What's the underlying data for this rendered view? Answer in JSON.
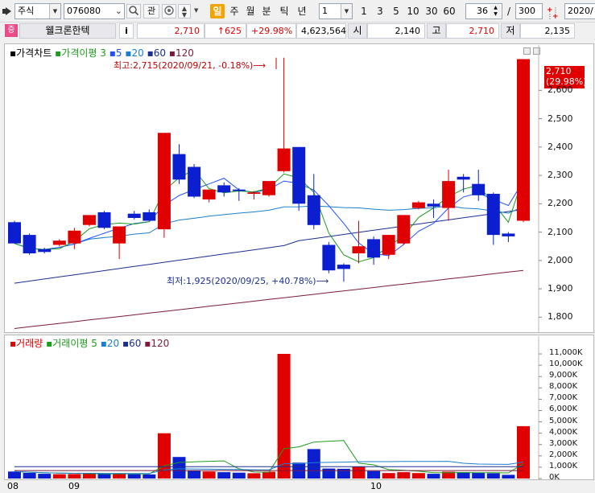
{
  "toolbar": {
    "market": "주식",
    "code": "076080",
    "search_icon": "search-icon",
    "watch_label": "관",
    "periods": [
      "일",
      "주",
      "월",
      "분",
      "틱",
      "년"
    ],
    "active_period": "일",
    "interval": "1",
    "quick_intervals": [
      "1",
      "3",
      "5",
      "10",
      "30",
      "60"
    ],
    "count": "36",
    "count_sep": "/",
    "max_count": "300",
    "date": "2020/"
  },
  "quote": {
    "badge": "증",
    "name": "웰크론한텍",
    "info": "i",
    "price": "2,710",
    "change": "↑625",
    "change_pct": "+29.98%",
    "volume": "4,623,564",
    "open_label": "시",
    "open": "2,140",
    "high_label": "고",
    "high": "2,710",
    "low_label": "저",
    "low": "2,135"
  },
  "price_panel": {
    "legend_main": "가격차트",
    "legend_ma": "가격이평",
    "ma_values": [
      "3",
      "5",
      "20",
      "60",
      "120"
    ],
    "annotation_high": "최고:2,715(2020/09/21, -0.18%)⟶",
    "annotation_low": "최저:1,925(2020/09/25, +40.78%)⟶",
    "current_price": "2,710",
    "current_pct": "(29.98%)",
    "y_ticks": [
      "2,600",
      "2,500",
      "2,400",
      "2,300",
      "2,200",
      "2,100",
      "2,000",
      "1,900",
      "1,800"
    ]
  },
  "volume_panel": {
    "legend_main": "거래량",
    "legend_ma": "거래이평",
    "ma_values": [
      "5",
      "20",
      "60",
      "120"
    ],
    "y_ticks": [
      "11,000K",
      "10,000K",
      "9,000K",
      "8,000K",
      "7,000K",
      "6,000K",
      "5,000K",
      "4,000K",
      "3,000K",
      "2,000K",
      "1,000K",
      "0K"
    ]
  },
  "x_axis": {
    "labels": [
      "08",
      "09",
      "10"
    ]
  },
  "colors": {
    "up": "#e00000",
    "down": "#0b1fd0",
    "ma3": "#1e9b1e",
    "ma5": "#1f50ff",
    "ma20": "#1a7fc9",
    "ma60": "#1a2f8f",
    "ma120": "#7b1a3a"
  },
  "chart_data": {
    "type": "candlestick",
    "ylim": [
      1750,
      2720
    ],
    "candles": [
      {
        "o": 2135,
        "h": 2140,
        "c": 2060,
        "l": 2060
      },
      {
        "o": 2090,
        "h": 2095,
        "c": 2025,
        "l": 2020
      },
      {
        "o": 2040,
        "h": 2045,
        "c": 2030,
        "l": 2025
      },
      {
        "o": 2055,
        "h": 2075,
        "c": 2070,
        "l": 2050
      },
      {
        "o": 2060,
        "h": 2115,
        "c": 2105,
        "l": 2040
      },
      {
        "o": 2125,
        "h": 2160,
        "c": 2160,
        "l": 2120
      },
      {
        "o": 2170,
        "h": 2175,
        "c": 2115,
        "l": 2110
      },
      {
        "o": 2060,
        "h": 2120,
        "c": 2120,
        "l": 2005
      },
      {
        "o": 2165,
        "h": 2175,
        "c": 2150,
        "l": 2145
      },
      {
        "o": 2170,
        "h": 2180,
        "c": 2140,
        "l": 2140
      },
      {
        "o": 2110,
        "h": 2450,
        "c": 2450,
        "l": 2080
      },
      {
        "o": 2375,
        "h": 2410,
        "c": 2285,
        "l": 2270
      },
      {
        "o": 2330,
        "h": 2340,
        "c": 2225,
        "l": 2220
      },
      {
        "o": 2215,
        "h": 2250,
        "c": 2250,
        "l": 2205
      },
      {
        "o": 2265,
        "h": 2275,
        "c": 2240,
        "l": 2225
      },
      {
        "o": 2250,
        "h": 2255,
        "c": 2245,
        "l": 2210
      },
      {
        "o": 2235,
        "h": 2245,
        "c": 2240,
        "l": 2215
      },
      {
        "o": 2230,
        "h": 2280,
        "c": 2280,
        "l": 2225
      },
      {
        "o": 2315,
        "h": 2715,
        "c": 2395,
        "l": 2310
      },
      {
        "o": 2400,
        "h": 2400,
        "c": 2200,
        "l": 2175
      },
      {
        "o": 2230,
        "h": 2305,
        "c": 2125,
        "l": 2110
      },
      {
        "o": 2055,
        "h": 2065,
        "c": 1965,
        "l": 1955
      },
      {
        "o": 1985,
        "h": 1990,
        "c": 1970,
        "l": 1925
      },
      {
        "o": 2025,
        "h": 2140,
        "c": 2050,
        "l": 1990
      },
      {
        "o": 2075,
        "h": 2085,
        "c": 2010,
        "l": 1985
      },
      {
        "o": 2020,
        "h": 2090,
        "c": 2090,
        "l": 2005
      },
      {
        "o": 2060,
        "h": 2160,
        "c": 2160,
        "l": 2055
      },
      {
        "o": 2185,
        "h": 2210,
        "c": 2205,
        "l": 2180
      },
      {
        "o": 2200,
        "h": 2215,
        "c": 2190,
        "l": 2150
      },
      {
        "o": 2185,
        "h": 2320,
        "c": 2280,
        "l": 2140
      },
      {
        "o": 2295,
        "h": 2305,
        "c": 2285,
        "l": 2240
      },
      {
        "o": 2270,
        "h": 2320,
        "c": 2230,
        "l": 2210
      },
      {
        "o": 2235,
        "h": 2240,
        "c": 2090,
        "l": 2055
      },
      {
        "o": 2095,
        "h": 2100,
        "c": 2085,
        "l": 2065
      },
      {
        "o": 2140,
        "h": 2710,
        "c": 2710,
        "l": 2135
      }
    ],
    "volume_k": [
      620,
      500,
      420,
      380,
      400,
      480,
      390,
      450,
      380,
      360,
      4000,
      1900,
      700,
      620,
      560,
      520,
      470,
      600,
      11000,
      1400,
      2600,
      880,
      860,
      1050,
      660,
      480,
      560,
      480,
      420,
      600,
      560,
      530,
      460,
      330,
      4620
    ],
    "vylim": [
      0,
      11500
    ]
  }
}
